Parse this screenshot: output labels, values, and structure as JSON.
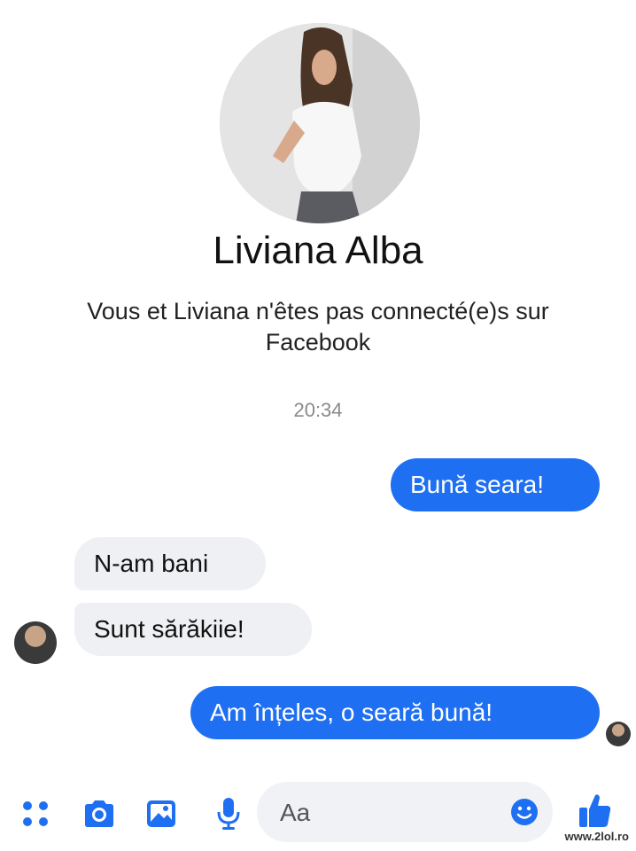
{
  "header": {
    "name": "Liviana Alba",
    "notice": "Vous et Liviana n'êtes pas connecté(e)s sur Facebook"
  },
  "timestamp": "20:34",
  "messages": [
    {
      "direction": "out",
      "text": "Bună seara!"
    },
    {
      "direction": "in",
      "text": "N-am bani"
    },
    {
      "direction": "in",
      "text": "Sunt sărăkiie!"
    },
    {
      "direction": "out",
      "text": "Am înțeles, o seară bună!"
    }
  ],
  "composer": {
    "placeholder": "Aa",
    "icons": [
      "menu-dots-icon",
      "camera-icon",
      "gallery-icon",
      "microphone-icon",
      "emoji-icon",
      "thumbs-up-icon"
    ]
  },
  "watermark": "www.2lol.ro",
  "colors": {
    "accent": "#1f6ff2",
    "incoming_bubble": "#eef0f3",
    "timestamp": "#8a8a8a"
  }
}
